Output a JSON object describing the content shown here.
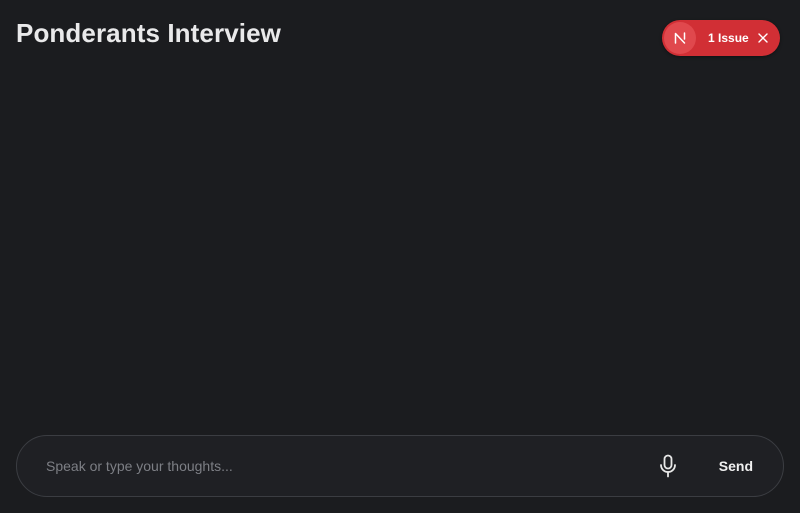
{
  "header": {
    "title": "Ponderants Interview"
  },
  "issue_badge": {
    "logo_icon": "nextjs-logo-icon",
    "label": "1 Issue",
    "close_icon": "close-icon",
    "color": "#d12f35"
  },
  "composer": {
    "placeholder": "Speak or type your thoughts...",
    "value": "",
    "mic_icon": "microphone-icon",
    "send_label": "Send"
  },
  "colors": {
    "background": "#1b1c1f",
    "composer_border": "#3b3d42",
    "badge": "#d12f35"
  }
}
